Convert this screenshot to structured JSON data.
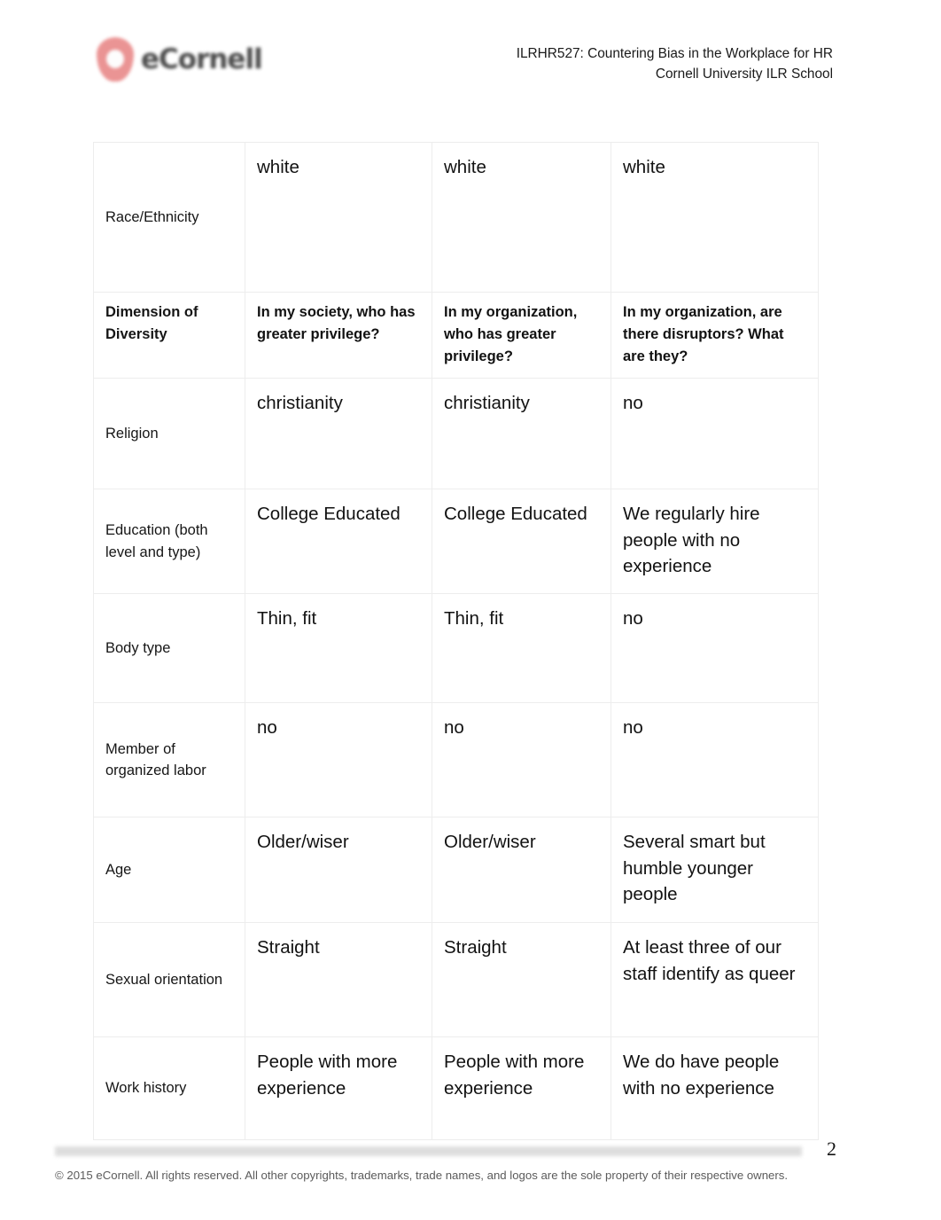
{
  "header": {
    "logo_text": "eCornell",
    "logo_icon": "ecornell-shield-logo",
    "course_title": "ILRHR527: Countering Bias in the Workplace for HR",
    "school": "Cornell University ILR School"
  },
  "table": {
    "rows": [
      {
        "label": "Race/Ethnicity",
        "bold": false,
        "cells": [
          "white",
          "white",
          "white"
        ]
      },
      {
        "label": "Dimension of Diversity",
        "bold": true,
        "cells": [
          "In my society, who has greater privilege?",
          "In my organization, who has greater privilege?",
          "In my organization, are there disruptors? What are they?"
        ]
      },
      {
        "label": "Religion",
        "bold": false,
        "cells": [
          "christianity",
          "christianity",
          "no"
        ]
      },
      {
        "label": "Education (both level and type)",
        "bold": false,
        "cells": [
          "College Educated",
          "College Educated",
          "We regularly hire people with no experience"
        ]
      },
      {
        "label": "Body type",
        "bold": false,
        "cells": [
          "Thin, fit",
          "Thin, fit",
          "no"
        ]
      },
      {
        "label": "Member of organized labor",
        "bold": false,
        "cells": [
          "no",
          "no",
          "no"
        ]
      },
      {
        "label": "Age",
        "bold": false,
        "cells": [
          "Older/wiser",
          "Older/wiser",
          "Several smart but humble younger people"
        ]
      },
      {
        "label": "Sexual orientation",
        "bold": false,
        "cells": [
          "Straight",
          "Straight",
          "At least three of our staff identify as queer"
        ]
      },
      {
        "label": "Work history",
        "bold": false,
        "cells": [
          "People with more experience",
          "People with more experience",
          "We do have people with no experience"
        ]
      }
    ]
  },
  "footer": {
    "page_number": "2",
    "copyright": "© 2015 eCornell. All rights reserved. All other copyrights, trademarks, trade names, and logos are the sole property of their respective owners."
  },
  "colors": {
    "logo_red": "#e98b8b",
    "border": "#ededed",
    "rule_gray": "#dcdcdc",
    "text": "#121212",
    "footer_text": "#5b5b5b"
  }
}
